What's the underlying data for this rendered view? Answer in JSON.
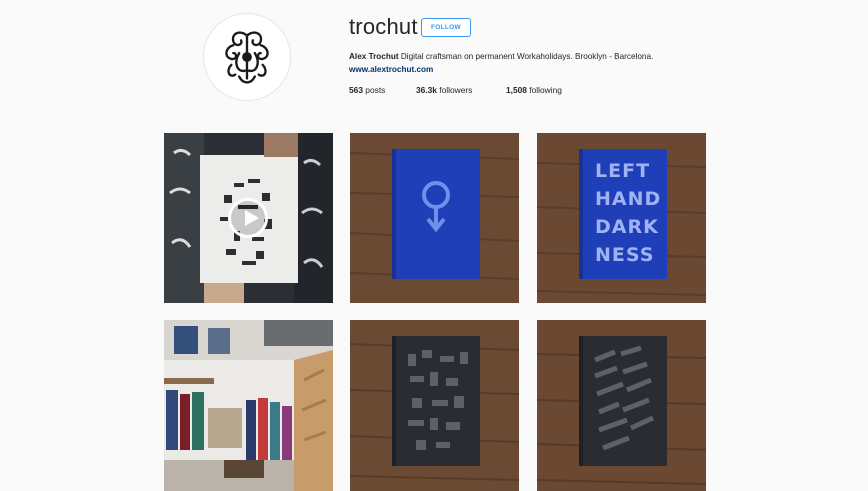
{
  "profile": {
    "username": "trochut",
    "follow_label": "FOLLOW",
    "full_name": "Alex Trochut",
    "bio": " Digital craftsman on permanent Workaholidays. Brooklyn - Barcelona.",
    "website": "www.alextrochut.com",
    "avatar_icon": "ornamental-monogram-logo",
    "stats": {
      "posts_count": "563",
      "posts_label": " posts",
      "followers_count": "36.3k",
      "followers_label": " followers",
      "following_count": "1,508",
      "following_label": " following"
    }
  },
  "colors": {
    "accent": "#3897f0",
    "link": "#003569",
    "background": "#fafafa",
    "book_blue": "#1f3fb8",
    "book_dark": "#2a2c33",
    "wood": "#6b4a33"
  },
  "posts": [
    {
      "kind": "video",
      "subject": "paper-stencil-poster",
      "has_play_icon": true
    },
    {
      "kind": "photo",
      "subject": "blue-book-symbol-cover"
    },
    {
      "kind": "photo",
      "subject": "blue-book-typography-cover",
      "cover_text": [
        "LEFT",
        "HAND",
        "DARK",
        "NESS"
      ]
    },
    {
      "kind": "photo",
      "subject": "store-interior"
    },
    {
      "kind": "photo",
      "subject": "dark-book-geometric-cover"
    },
    {
      "kind": "photo",
      "subject": "dark-book-lettering-cover"
    }
  ]
}
